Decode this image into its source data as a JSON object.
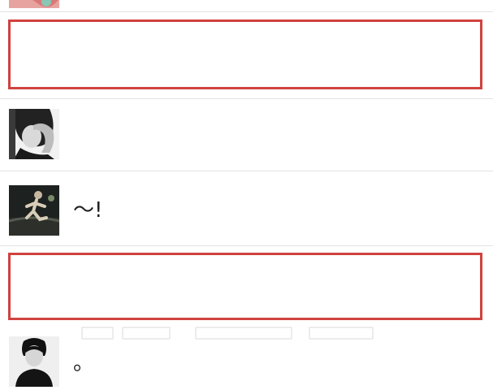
{
  "colors": {
    "background": "#ffffff",
    "divider": "#e3e3e3",
    "redaction_border": "#d0423f",
    "text": "#222222"
  },
  "rows": [
    {
      "avatar": "top-cropped-avatar",
      "message": ""
    },
    {
      "avatar": "redacted",
      "message": ""
    },
    {
      "avatar": "woman-hand-on-face-photo",
      "message": ""
    },
    {
      "avatar": "runner-sports-photo",
      "message": "～!"
    },
    {
      "avatar": "redacted",
      "message": ""
    },
    {
      "avatar": "man-portrait-photo",
      "message": "。"
    }
  ]
}
